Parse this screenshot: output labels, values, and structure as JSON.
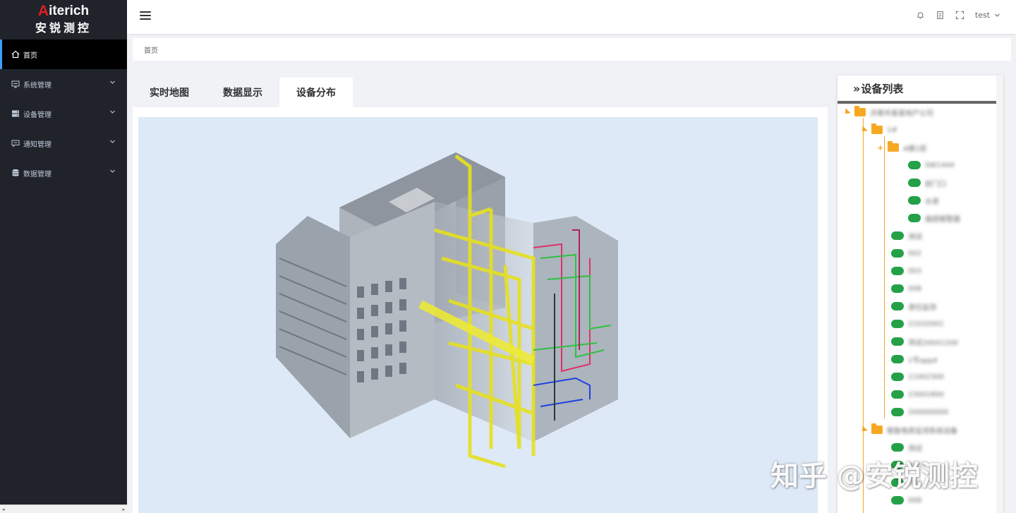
{
  "brand": {
    "logo_top": "iterich",
    "logo_letter": "A",
    "logo_bottom": "安锐测控"
  },
  "sidebar": {
    "items": [
      {
        "label": "首页",
        "icon": "home-icon"
      },
      {
        "label": "系统管理",
        "icon": "monitor-icon"
      },
      {
        "label": "设备管理",
        "icon": "server-icon"
      },
      {
        "label": "通知管理",
        "icon": "message-icon"
      },
      {
        "label": "数据管理",
        "icon": "database-icon"
      }
    ]
  },
  "header": {
    "user": "test"
  },
  "breadcrumb": {
    "home": "首页"
  },
  "tabs": [
    {
      "label": "实时地图"
    },
    {
      "label": "数据显示"
    },
    {
      "label": "设备分布"
    }
  ],
  "device_panel": {
    "title": "设备列表",
    "tree": [
      {
        "label": "济南市某某地产公司",
        "type": "folder",
        "depth": 0
      },
      {
        "label": "1#",
        "type": "folder",
        "depth": 1
      },
      {
        "label": "A楼1层",
        "type": "folder",
        "depth": 2
      },
      {
        "label": "SW1444",
        "type": "device",
        "depth": 3
      },
      {
        "label": "前门口",
        "type": "device",
        "depth": 3
      },
      {
        "label": "水表",
        "type": "device",
        "depth": 3
      },
      {
        "label": "烟感报警器",
        "type": "device",
        "depth": 3
      },
      {
        "label": "测试",
        "type": "device",
        "depth": 2
      },
      {
        "label": "002",
        "type": "device",
        "depth": 2
      },
      {
        "label": "003",
        "type": "device",
        "depth": 2
      },
      {
        "label": "008",
        "type": "device",
        "depth": 2
      },
      {
        "label": "液位监测",
        "type": "device",
        "depth": 2
      },
      {
        "label": "21032001",
        "type": "device",
        "depth": 2
      },
      {
        "label": "测试20041200",
        "type": "device",
        "depth": 2
      },
      {
        "label": "1号app4",
        "type": "device",
        "depth": 2
      },
      {
        "label": "11002300",
        "type": "device",
        "depth": 2
      },
      {
        "label": "23001800",
        "type": "device",
        "depth": 2
      },
      {
        "label": "200000000",
        "type": "device",
        "depth": 2
      },
      {
        "label": "智能电表监测系统设备",
        "type": "folder",
        "depth": 1
      },
      {
        "label": "测试",
        "type": "device",
        "depth": 2
      },
      {
        "label": "0001",
        "type": "device",
        "depth": 2
      },
      {
        "label": "006",
        "type": "device",
        "depth": 2
      },
      {
        "label": "008",
        "type": "device",
        "depth": 2
      }
    ]
  },
  "watermark": "知乎 @安锐测控"
}
